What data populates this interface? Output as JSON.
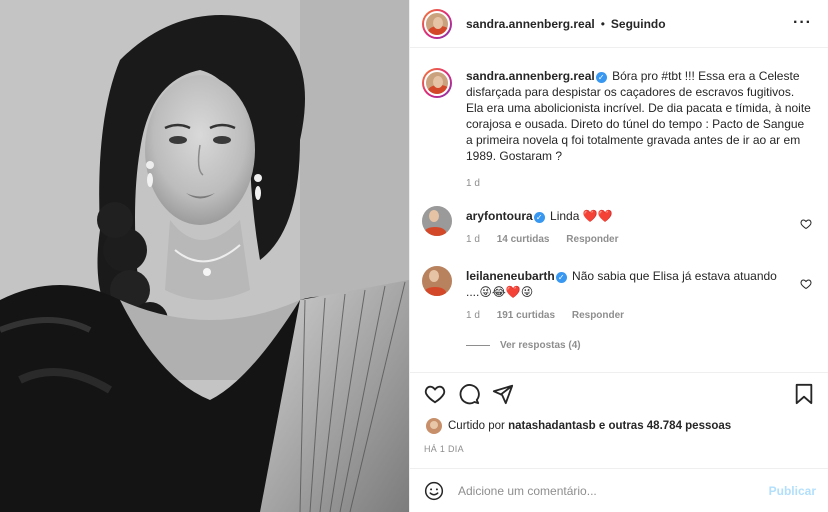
{
  "post": {
    "username": "sandra.annenberg.real",
    "separator": "•",
    "follow_status": "Seguindo",
    "more_icon": "more-horizontal-icon"
  },
  "caption": {
    "username": "sandra.annenberg.real",
    "text": "Bóra pro #tbt !!! Essa era a Celeste disfarçada para despistar os caçadores de escravos fugitivos. Ela era uma abolicionista incrível. De dia pacata e tímida, à noite corajosa e ousada. Direto do túnel do tempo : Pacto de Sangue a primeira novela q foi totalmente gravada antes de ir ao ar em 1989. Gostaram ?",
    "time": "1 d"
  },
  "comments": [
    {
      "username": "aryfontoura",
      "text": "Linda ❤️❤️",
      "time": "1 d",
      "likes": "14 curtidas",
      "reply": "Responder"
    },
    {
      "username": "leilaneneubarth",
      "text": "Não sabia que Elisa já estava atuando ....😜😂❤️😜",
      "time": "1 d",
      "likes": "191 curtidas",
      "reply": "Responder",
      "view_replies": "Ver respostas (4)"
    }
  ],
  "likes": {
    "prefix": "Curtido por",
    "user": "natashadantasb",
    "suffix": "e outras 48.784 pessoas"
  },
  "date": "HÁ 1 DIA",
  "composer": {
    "placeholder": "Adicione um comentário...",
    "publish": "Publicar"
  },
  "colors": {
    "accent": "#3897f0",
    "publish_disabled": "#b2dffc",
    "heart": "#ed4956",
    "muted": "#8e8e8e"
  }
}
